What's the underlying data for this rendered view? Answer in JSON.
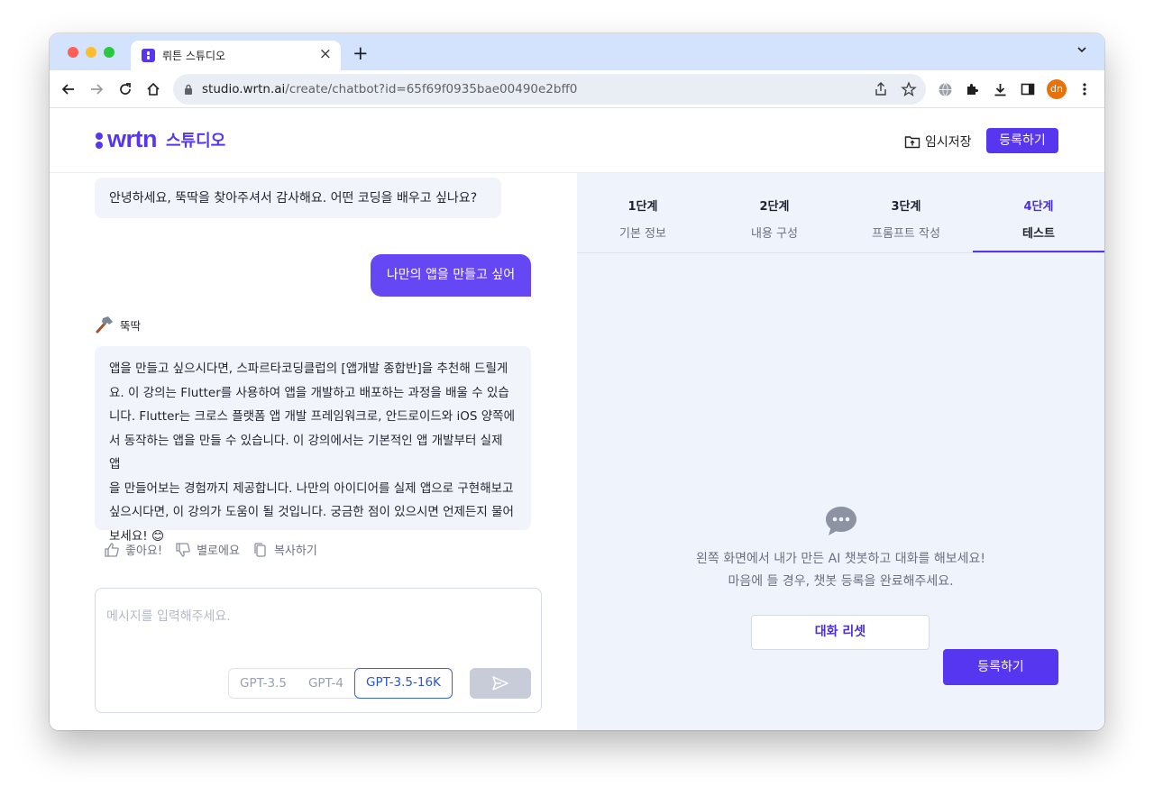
{
  "browser": {
    "tab_title": "뤼튼 스튜디오",
    "url_host": "studio.wrtn.ai",
    "url_path": "/create/chatbot?id=65f69f0935bae00490e2bff0",
    "profile_initials": "dn"
  },
  "header": {
    "logo_word": "wrtn",
    "logo_sub": "스튜디오",
    "save_temp_label": "임시저장",
    "register_label": "등록하기"
  },
  "chat": {
    "greeting": "안녕하세요, 뚝딱을 찾아주셔서 감사해요. 어떤 코딩을 배우고 싶나요?",
    "user_message": "나만의 앱을 만들고 싶어",
    "bot_name": "뚝딱",
    "bot_answer_lines": [
      "앱을 만들고 싶으시다면, 스파르타코딩클럽의 [앱개발 종합반]을 추천해 드릴게",
      "요. 이 강의는 Flutter를 사용하여 앱을 개발하고 배포하는 과정을 배울 수 있습",
      "니다. Flutter는 크로스 플랫폼 앱 개발 프레임워크로, 안드로이드와 iOS 양쪽에",
      "서 동작하는 앱을 만들 수 있습니다. 이 강의에서는 기본적인 앱 개발부터 실제 앱",
      "을 만들어보는 경험까지 제공합니다. 나만의 아이디어를 실제 앱으로 구현해보고",
      "싶으시다면, 이 강의가 도움이 될 것입니다. 궁금한 점이 있으시면 언제든지 물어",
      "보세요! 😊"
    ],
    "feedback": {
      "like": "좋아요!",
      "dislike": "별로에요",
      "copy": "복사하기"
    },
    "input_placeholder": "메시지를 입력해주세요.",
    "models": [
      "GPT-3.5",
      "GPT-4",
      "GPT-3.5-16K"
    ],
    "selected_model": "GPT-3.5-16K"
  },
  "panel": {
    "steps": [
      {
        "num": "1단계",
        "label": "기본 정보"
      },
      {
        "num": "2단계",
        "label": "내용 구성"
      },
      {
        "num": "3단계",
        "label": "프롬프트 작성"
      },
      {
        "num": "4단계",
        "label": "테스트"
      }
    ],
    "active_step": 4,
    "empty_line1": "왼쪽 화면에서 내가 만든 AI 챗봇하고 대화를 해보세요!",
    "empty_line2": "마음에 들 경우, 챗봇 등록을 완료해주세요.",
    "reset_label": "대화 리셋",
    "register_label": "등록하기"
  },
  "colors": {
    "brand": "#5736ef",
    "user_bubble": "#6547f3",
    "panel_bg": "#eff3fc",
    "tabstrip": "#d3e3fd"
  }
}
